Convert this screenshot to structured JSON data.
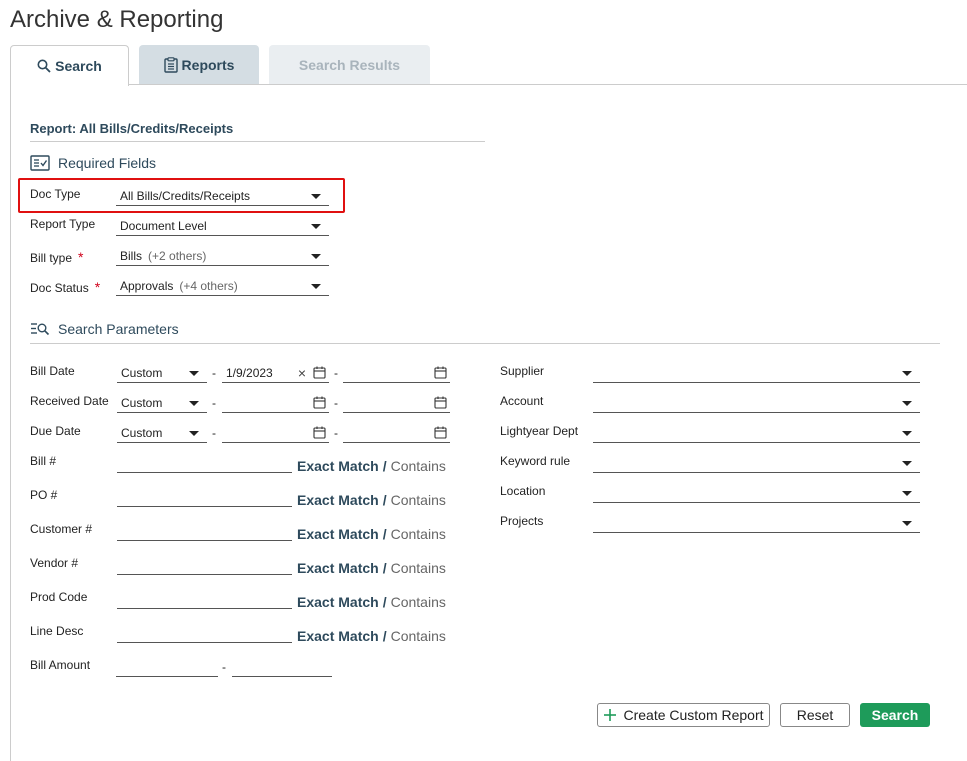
{
  "page_title": "Archive & Reporting",
  "tabs": [
    {
      "label": "Search",
      "icon": "search-icon",
      "active": true
    },
    {
      "label": "Reports",
      "icon": "clipboard-icon",
      "active": false
    },
    {
      "label": "Search Results",
      "active": false,
      "disabled": true
    }
  ],
  "report_title": "Report: All Bills/Credits/Receipts",
  "required": {
    "heading": "Required Fields",
    "doc_type": {
      "label": "Doc Type",
      "value": "All Bills/Credits/Receipts"
    },
    "report_type": {
      "label": "Report Type",
      "value": "Document Level"
    },
    "bill_type": {
      "label": "Bill type",
      "value": "Bills",
      "extra": "(+2 others)",
      "required_mark": "*"
    },
    "doc_status": {
      "label": "Doc Status",
      "value": "Approvals",
      "extra": "(+4 others)",
      "required_mark": "*"
    }
  },
  "params": {
    "heading": "Search Parameters",
    "bill_date": {
      "label": "Bill Date",
      "mode": "Custom",
      "from": "1/9/2023",
      "clear": "×",
      "to": ""
    },
    "received_date": {
      "label": "Received Date",
      "mode": "Custom",
      "from": "",
      "to": ""
    },
    "due_date": {
      "label": "Due Date",
      "mode": "Custom",
      "from": "",
      "to": ""
    },
    "dash": "-",
    "text_fields": [
      {
        "label": "Bill #",
        "value": ""
      },
      {
        "label": "PO #",
        "value": ""
      },
      {
        "label": "Customer #",
        "value": ""
      },
      {
        "label": "Vendor #",
        "value": ""
      },
      {
        "label": "Prod Code",
        "value": ""
      },
      {
        "label": "Line Desc",
        "value": ""
      }
    ],
    "match": {
      "exact": "Exact Match",
      "slash": "/",
      "contains": "Contains"
    },
    "bill_amount": {
      "label": "Bill Amount",
      "from": "",
      "to": ""
    },
    "right_fields": [
      {
        "label": "Supplier",
        "value": ""
      },
      {
        "label": "Account",
        "value": ""
      },
      {
        "label": "Lightyear Dept",
        "value": ""
      },
      {
        "label": "Keyword rule",
        "value": ""
      },
      {
        "label": "Location",
        "value": ""
      },
      {
        "label": "Projects",
        "value": ""
      }
    ]
  },
  "buttons": {
    "create_custom": "Create Custom Report",
    "reset": "Reset",
    "search": "Search"
  },
  "colors": {
    "accent": "#2e4a5c",
    "primary_button": "#1e9b5a",
    "required": "#d0021b",
    "highlight": "#e01010"
  }
}
